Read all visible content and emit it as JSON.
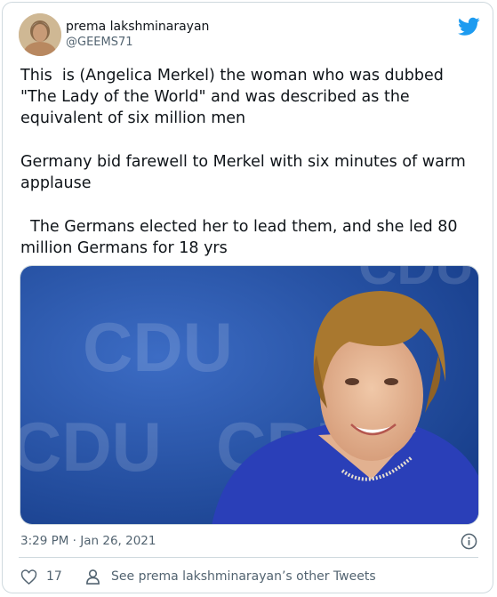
{
  "author": {
    "name": "prema lakshminarayan",
    "handle": "@GEEMS71"
  },
  "tweet": {
    "lines": [
      "This  is (Angelica Merkel) the woman who was dubbed",
      "\"The Lady of the World\" and was described as the",
      "equivalent of six million men",
      "Germany bid farewell to Merkel with six minutes of warm",
      "applause",
      "  The Germans elected her to lead them, and she led 80",
      "million Germans for 18 yrs"
    ]
  },
  "photo": {
    "backdrop_text": [
      "CDU",
      "CDU",
      "CDU",
      "CDU"
    ]
  },
  "meta": {
    "timestamp": "3:29 PM · Jan 26, 2021"
  },
  "footer": {
    "like_count": "17",
    "see_more": "See prema lakshminarayan’s other Tweets"
  },
  "colors": {
    "twitter_blue": "#1d9bf0",
    "muted": "#536471",
    "cdu_backdrop": "#1f4a9c"
  },
  "icons": [
    "twitter-bird-icon",
    "info-icon",
    "heart-icon",
    "person-icon"
  ]
}
